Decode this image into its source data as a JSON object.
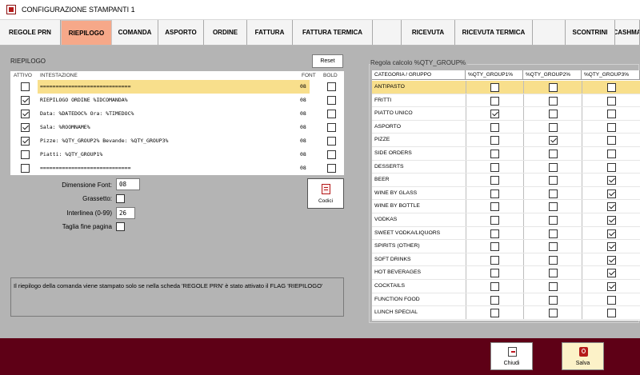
{
  "window": {
    "title": "CONFIGURAZIONE STAMPANTI 1"
  },
  "tabs": [
    {
      "label": "REGOLE PRN",
      "active": false
    },
    {
      "label": "RIEPILOGO",
      "active": true
    },
    {
      "label": "COMANDA",
      "active": false
    },
    {
      "label": "ASPORTO",
      "active": false
    },
    {
      "label": "ORDINE",
      "active": false
    },
    {
      "label": "FATTURA",
      "active": false
    },
    {
      "label": "FATTURA TERMICA",
      "active": false
    },
    {
      "label": "",
      "active": false
    },
    {
      "label": "RICEVUTA",
      "active": false
    },
    {
      "label": "RICEVUTA TERMICA",
      "active": false
    },
    {
      "label": "",
      "active": false
    },
    {
      "label": "SCONTRINI",
      "active": false
    },
    {
      "label": "CASHMA",
      "active": false
    }
  ],
  "riepilogo": {
    "section_label": "RIEPILOGO",
    "reset_label": "Reset",
    "columns": {
      "attivo": "ATTIVO",
      "intestazione": "INTESTAZIONE",
      "font": "FONT",
      "bold": "BOLD"
    },
    "rows": [
      {
        "active": false,
        "text": "=============================",
        "font": "08",
        "bold": false,
        "selected": true
      },
      {
        "active": true,
        "text": "RIEPILOGO ORDINE %IDCOMANDA%",
        "font": "08",
        "bold": false,
        "selected": false
      },
      {
        "active": true,
        "text": "Data: %DATEDOC%  Ora: %TIMEDOC%",
        "font": "08",
        "bold": false,
        "selected": false
      },
      {
        "active": true,
        "text": "Sala: %ROOMNAME%",
        "font": "08",
        "bold": false,
        "selected": false
      },
      {
        "active": true,
        "text": "Pizze: %QTY_GROUP2%  Bevande: %QTY_GROUP3%",
        "font": "08",
        "bold": false,
        "selected": false
      },
      {
        "active": false,
        "text": "Piatti: %QTY_GROUP1%",
        "font": "08",
        "bold": false,
        "selected": false
      },
      {
        "active": false,
        "text": "=============================",
        "font": "08",
        "bold": false,
        "selected": false
      }
    ]
  },
  "settings": {
    "dimensione_font_label": "Dimensione Font:",
    "dimensione_font_value": "08",
    "grassetto_label": "Grassetto:",
    "grassetto_checked": false,
    "interlinea_label": "Interlinea (0-99)",
    "interlinea_value": "26",
    "taglia_label": "Taglia fine pagina",
    "taglia_checked": false,
    "codici_label": "Codici"
  },
  "info_text": "Il riepilogo della comanda viene stampato solo se nella scheda 'REGOLE PRN' è stato attivato il FLAG 'RIEPILOGO'",
  "group_rules": {
    "label": "Regola calcolo %QTY_GROUP%",
    "columns": [
      "CATEGORIA / GRUPPO",
      "%QTY_GROUP1%",
      "%QTY_GROUP2%",
      "%QTY_GROUP3%"
    ],
    "rows": [
      {
        "category": "ANTIPASTO",
        "g1": false,
        "g2": false,
        "g3": false,
        "selected": true
      },
      {
        "category": "FRITTI",
        "g1": false,
        "g2": false,
        "g3": false,
        "selected": false
      },
      {
        "category": "PIATTO UNICO",
        "g1": true,
        "g2": false,
        "g3": false,
        "selected": false
      },
      {
        "category": "ASPORTO",
        "g1": false,
        "g2": false,
        "g3": false,
        "selected": false
      },
      {
        "category": "PIZZE",
        "g1": false,
        "g2": true,
        "g3": false,
        "selected": false
      },
      {
        "category": "SIDE ORDERS",
        "g1": false,
        "g2": false,
        "g3": false,
        "selected": false
      },
      {
        "category": "DESSERTS",
        "g1": false,
        "g2": false,
        "g3": false,
        "selected": false
      },
      {
        "category": "BEER",
        "g1": false,
        "g2": false,
        "g3": true,
        "selected": false
      },
      {
        "category": "WINE BY GLASS",
        "g1": false,
        "g2": false,
        "g3": true,
        "selected": false
      },
      {
        "category": "WINE BY BOTTLE",
        "g1": false,
        "g2": false,
        "g3": true,
        "selected": false
      },
      {
        "category": "VODKAS",
        "g1": false,
        "g2": false,
        "g3": true,
        "selected": false
      },
      {
        "category": "SWEET VODKA/LIQUORS",
        "g1": false,
        "g2": false,
        "g3": true,
        "selected": false
      },
      {
        "category": "SPIRITS (OTHER)",
        "g1": false,
        "g2": false,
        "g3": true,
        "selected": false
      },
      {
        "category": "SOFT DRINKS",
        "g1": false,
        "g2": false,
        "g3": true,
        "selected": false
      },
      {
        "category": "HOT BEVERAGES",
        "g1": false,
        "g2": false,
        "g3": true,
        "selected": false
      },
      {
        "category": "COCKTAILS",
        "g1": false,
        "g2": false,
        "g3": true,
        "selected": false
      },
      {
        "category": "FUNCTION FOOD",
        "g1": false,
        "g2": false,
        "g3": false,
        "selected": false
      },
      {
        "category": "LUNCH SPECIAL",
        "g1": false,
        "g2": false,
        "g3": false,
        "selected": false
      }
    ]
  },
  "footer": {
    "chiudi_label": "Chiudi",
    "salva_label": "Salva"
  },
  "colors": {
    "active_tab": "#f6a889",
    "selected_row": "#f8df8c",
    "footer_bg": "#5e0016",
    "panel_bg": "#b4b4b4"
  },
  "icons": {
    "app": "printer-config-icon",
    "codici": "document-icon",
    "chiudi": "exit-door-icon",
    "salva": "save-icon"
  }
}
